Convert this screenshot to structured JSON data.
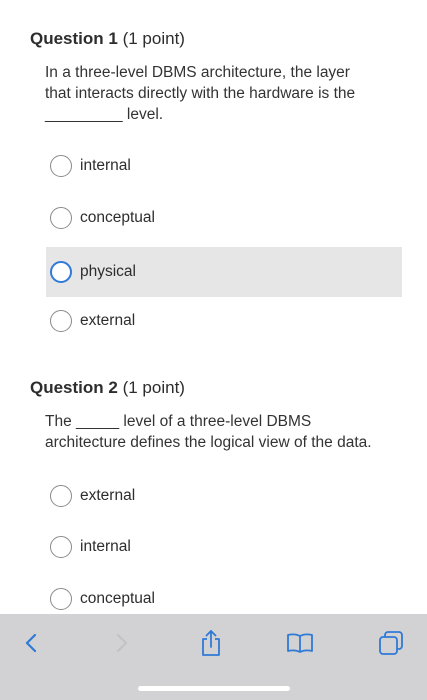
{
  "questions": [
    {
      "title": "Question 1",
      "points": "(1 point)",
      "text_lines": [
        "In a three-level DBMS architecture, the layer",
        "that interacts directly with the hardware is the",
        "_________ level."
      ],
      "options": [
        "internal",
        "conceptual",
        "physical",
        "external"
      ],
      "selected_index": 2
    },
    {
      "title": "Question 2",
      "points": "(1 point)",
      "text_lines": [
        "The _____ level of a three-level DBMS",
        "architecture defines the logical view of the data."
      ],
      "options": [
        "external",
        "internal",
        "conceptual"
      ]
    }
  ],
  "toolbar": {
    "buttons": [
      "back-icon",
      "forward-icon",
      "share-icon",
      "bookmarks-icon",
      "tabs-icon"
    ],
    "back_enabled": true,
    "forward_enabled": false,
    "accent_color": "#2f7ad6"
  }
}
